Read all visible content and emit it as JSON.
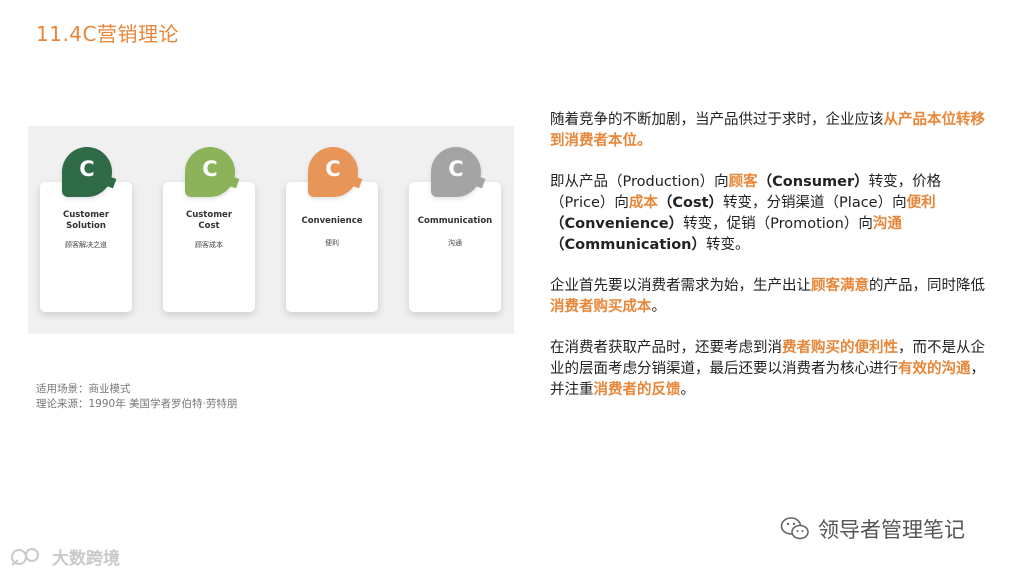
{
  "title": "11.4C营销理论",
  "cards": [
    {
      "letter": "C",
      "color": "#2f6b46",
      "en": "Customer\nSolution",
      "cn": "顾客解决之道"
    },
    {
      "letter": "C",
      "color": "#8db35a",
      "en": "Customer\nCost",
      "cn": "顾客成本"
    },
    {
      "letter": "C",
      "color": "#e8955a",
      "en": "Convenience",
      "cn": "便利"
    },
    {
      "letter": "C",
      "color": "#a4a4a4",
      "en": "Communication",
      "cn": "沟通"
    }
  ],
  "meta": {
    "scene": "适用场景：商业模式",
    "source": "理论来源：1990年 美国学者罗伯特·劳特朋"
  },
  "paragraphs": {
    "p1": {
      "t1": "随着竞争的不断加剧，当产品供过于求时，企业应该",
      "h1": "从产品本位转移到消费者本位。"
    },
    "p2": {
      "t1": "即从产品（Production）向",
      "h1": "顾客",
      "b1": "（Consumer）",
      "t2": "转变，价格（Price）向",
      "h2": "成本",
      "b2": "（Cost）",
      "t3": "转变，分销渠道（Place）向",
      "h3": "便利",
      "b3": "（Convenience）",
      "t4": "转变，促销（Promotion）向",
      "h4": "沟通",
      "b4": "（Communication）",
      "t5": "转变。"
    },
    "p3": {
      "t1": "企业首先要以消费者需求为始，生产出让",
      "h1": "顾客满意",
      "t2": "的产品，同时降低",
      "h2": "消费者购买成本",
      "t3": "。"
    },
    "p4": {
      "t1": "在消费者获取产品时，还要考虑到消",
      "h1": "费者购买的便利性",
      "t2": "，而不是从企业的层面考虑分销渠道，最后还要以消费者为核心进行",
      "h2": "有效的沟通",
      "t3": "，并注重",
      "h3": "消费者的反馈",
      "t4": "。"
    }
  },
  "wechat": {
    "label": "领导者管理笔记"
  },
  "watermark": {
    "label": "大数跨境"
  }
}
